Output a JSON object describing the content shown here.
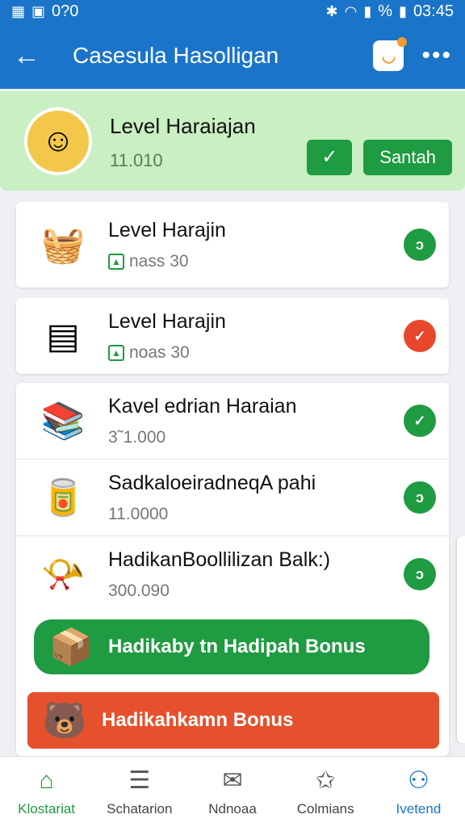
{
  "status_bar": {
    "left_text": "0?0",
    "percent": "%",
    "time": "03:45",
    "icons": [
      "sim-icon",
      "image-icon",
      "bluetooth-icon",
      "wifi-icon",
      "signal-icon",
      "battery-icon"
    ]
  },
  "app_bar": {
    "title": "Casesula Hasolligan",
    "icons": [
      "back-arrow-icon",
      "chat-icon",
      "more-icon"
    ]
  },
  "profile": {
    "name": "Level Haraiajan",
    "score": "11.010",
    "action_label": "Santah",
    "avatar_icon": "avatar-icon"
  },
  "tasks": [
    {
      "title": "Level Harajin",
      "sub": "nass 30",
      "icon": "basket-icon",
      "status": "green"
    },
    {
      "title": "Level Harajin",
      "sub": "noas 30",
      "icon": "tablet-icon",
      "status": "red"
    }
  ],
  "rewards": [
    {
      "title": "Kavel edrian Haraian",
      "value": "3˜1.000",
      "icon": "books-icon"
    },
    {
      "title": "SadkaloeiradneqA pahi",
      "value": "11.0000",
      "icon": "can-icon"
    },
    {
      "title": "HadikanBoollilizan Balk:)",
      "value": "300.090",
      "icon": "horn-icon"
    }
  ],
  "banners": {
    "green": "Hadikaby tn Hadipah Bonus",
    "red": "Hadikahkamn Bonus"
  },
  "bottom_nav": [
    {
      "label": "Klostariat",
      "icon": "home-icon"
    },
    {
      "label": "Schatarion",
      "icon": "list-icon"
    },
    {
      "label": "Ndnoaa",
      "icon": "inbox-icon"
    },
    {
      "label": "Colmians",
      "icon": "star-icon"
    },
    {
      "label": "Ivetend",
      "icon": "user-icon"
    }
  ],
  "colors": {
    "primary_blue": "#1a74c9",
    "green": "#1f9b41",
    "red": "#e8472b",
    "profile_bg": "#c9efc2"
  }
}
